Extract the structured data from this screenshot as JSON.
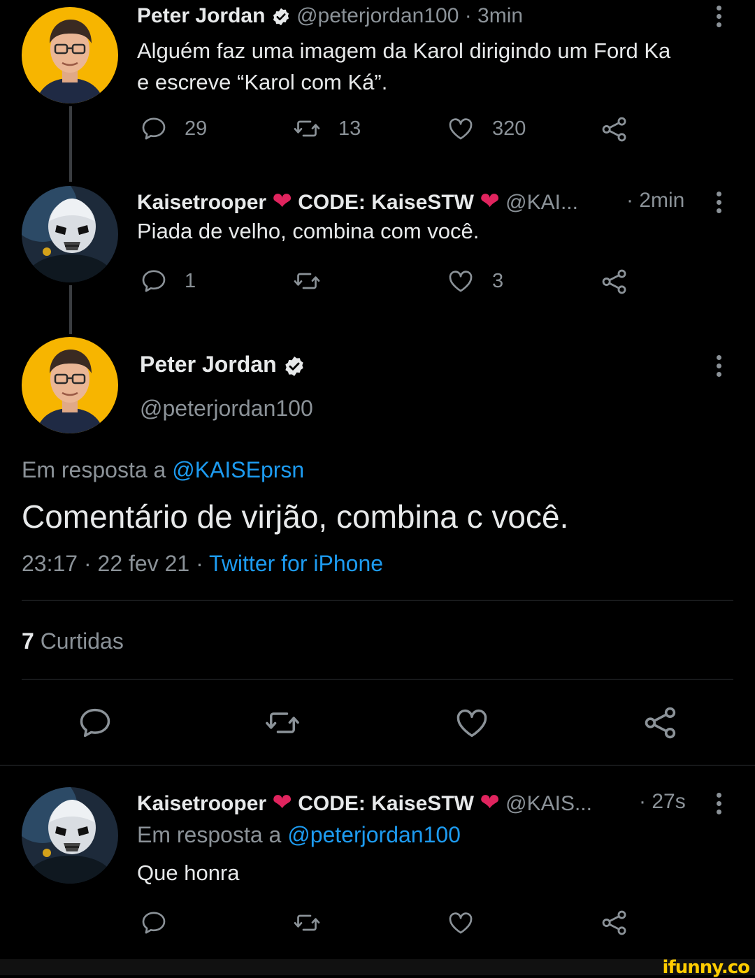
{
  "tweet1": {
    "name": "Peter Jordan",
    "handle": "@peterjordan100",
    "time": "· 3min",
    "text_line1": "Alguém faz uma imagem da Karol dirigindo um Ford Ka",
    "text_line2": "e escreve “Karol com Ká”.",
    "replies": "29",
    "retweets": "13",
    "likes": "320"
  },
  "tweet2": {
    "name_part1": "Kaisetrooper",
    "name_part2": "CODE: KaiseSTW",
    "heart": "❤",
    "handle": "@KAI...",
    "time": "· 2min",
    "text": "Piada de velho, combina com você.",
    "replies": "1",
    "retweets": "",
    "likes": "3"
  },
  "main": {
    "name": "Peter Jordan",
    "handle": "@peterjordan100",
    "reply_prefix": "Em resposta a",
    "reply_to": "@KAISEprsn",
    "text": "Comentário de virjão, combina c você.",
    "timestamp": "23:17 · 22 fev 21 ·",
    "source": "Twitter for iPhone",
    "likes_count": "7",
    "likes_label": "Curtidas"
  },
  "tweet3": {
    "name_part1": "Kaisetrooper",
    "name_part2": "CODE: KaiseSTW",
    "heart": "❤",
    "handle": "@KAIS...",
    "time": "· 27s",
    "reply_prefix": "Em resposta a",
    "reply_to": "@peterjordan100",
    "text": "Que honra"
  },
  "watermark": "ifunny.co",
  "colors": {
    "background": "#000000",
    "link": "#1d9bf0",
    "muted": "#8b9298",
    "heart": "#e0245e",
    "avatar_bg": "#f7b500"
  }
}
